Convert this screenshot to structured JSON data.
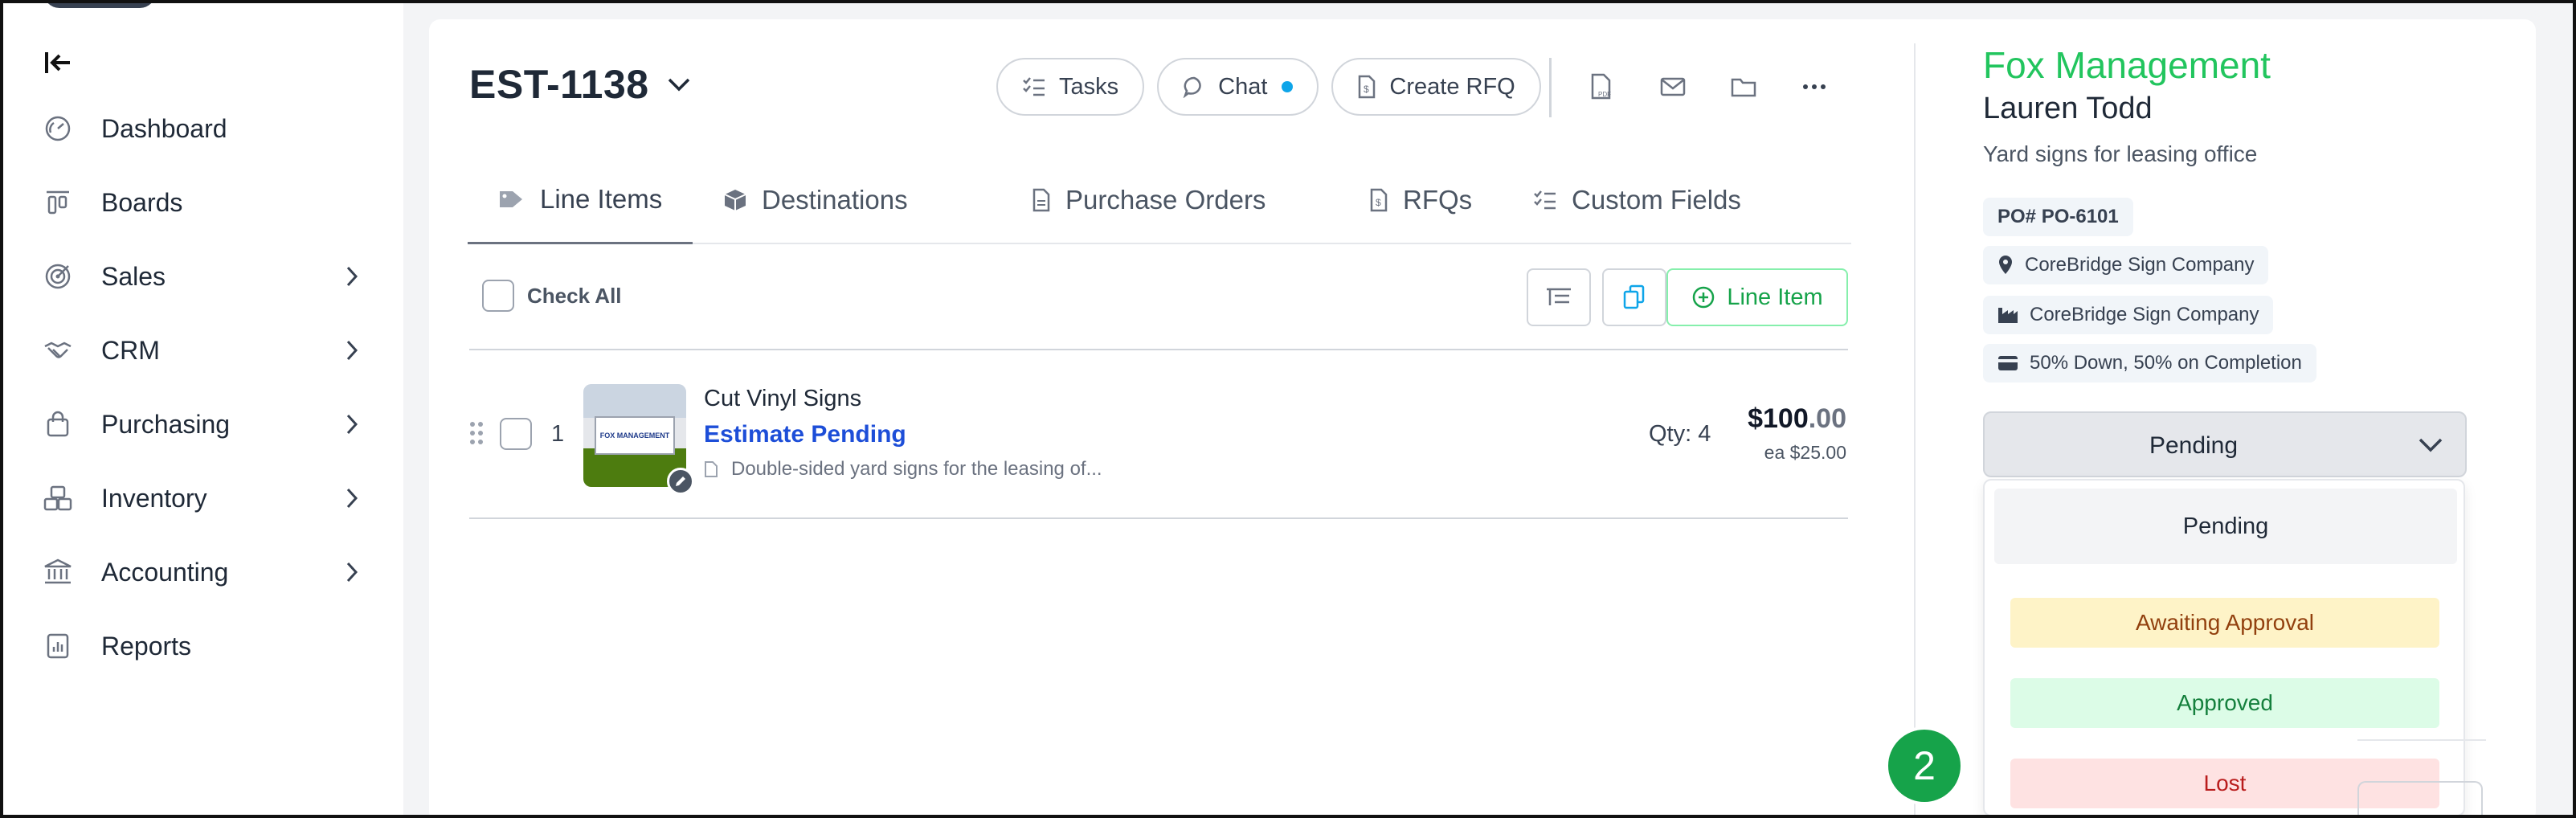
{
  "sidebar": {
    "items": [
      {
        "label": "Dashboard",
        "icon": "dashboard-icon",
        "expandable": false
      },
      {
        "label": "Boards",
        "icon": "boards-icon",
        "expandable": false
      },
      {
        "label": "Sales",
        "icon": "sales-icon",
        "expandable": true
      },
      {
        "label": "CRM",
        "icon": "handshake-icon",
        "expandable": true
      },
      {
        "label": "Purchasing",
        "icon": "shopping-bag-icon",
        "expandable": true
      },
      {
        "label": "Inventory",
        "icon": "boxes-icon",
        "expandable": true
      },
      {
        "label": "Accounting",
        "icon": "bank-icon",
        "expandable": true
      },
      {
        "label": "Reports",
        "icon": "report-icon",
        "expandable": false
      }
    ]
  },
  "header": {
    "estimate_id": "EST-1138",
    "buttons": {
      "tasks": "Tasks",
      "chat": "Chat",
      "create_rfq": "Create RFQ"
    }
  },
  "tabs": [
    {
      "label": "Line Items",
      "active": true
    },
    {
      "label": "Destinations",
      "active": false
    },
    {
      "label": "Purchase Orders",
      "active": false
    },
    {
      "label": "RFQs",
      "active": false
    },
    {
      "label": "Custom Fields",
      "active": false
    }
  ],
  "line_items": {
    "check_all_label": "Check All",
    "add_button_label": "Line Item",
    "rows": [
      {
        "number": "1",
        "thumbnail_text": "FOX MANAGEMENT",
        "name": "Cut Vinyl Signs",
        "status": "Estimate Pending",
        "description": "Double-sided yard signs for the leasing of...",
        "qty": "Qty: 4",
        "price_dollars": "$100",
        "price_cents": ".00",
        "each": "ea $25.00"
      }
    ]
  },
  "customer": {
    "company": "Fox Management",
    "contact": "Lauren Todd",
    "project": "Yard signs for leasing office",
    "po": "PO# PO-6101",
    "location": "CoreBridge Sign Company",
    "facility": "CoreBridge Sign Company",
    "terms": "50% Down, 50% on Completion"
  },
  "status": {
    "selected": "Pending",
    "options": [
      "Pending",
      "Awaiting Approval",
      "Approved",
      "Lost"
    ]
  },
  "step_badge": "2",
  "colors": {
    "brand_green": "#22c55e",
    "link_blue": "#1d4ed8",
    "chat_dot": "#0ea5e9"
  }
}
